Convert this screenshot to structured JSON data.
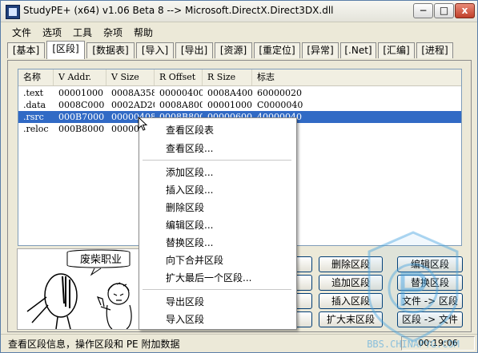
{
  "window": {
    "title": "StudyPE+ (x64) v1.06 Beta 8  --> Microsoft.DirectX.Direct3DX.dll",
    "controls": [
      "−",
      "□",
      "x"
    ]
  },
  "menu": [
    "文件",
    "选项",
    "工具",
    "杂项",
    "帮助"
  ],
  "tabs": [
    "[基本]",
    "[区段]",
    "[数据表]",
    "[导入]",
    "[导出]",
    "[资源]",
    "[重定位]",
    "[异常]",
    "[.Net]",
    "[汇编]",
    "[进程]"
  ],
  "table": {
    "columns": [
      "名称",
      "V Addr.",
      "V Size",
      "R Offset",
      "R Size",
      "标志"
    ],
    "rows": [
      [
        ".text",
        "00001000",
        "0008A358",
        "00000400",
        "0008A400",
        "60000020"
      ],
      [
        ".data",
        "0008C000",
        "0002AD20",
        "0008A800",
        "00001000",
        "C0000040"
      ],
      [
        ".rsrc",
        "000B7000",
        "00000408",
        "0008B800",
        "00000600",
        "40000040"
      ],
      [
        ".reloc",
        "000B8000",
        "00000A",
        "",
        "",
        ""
      ]
    ],
    "selected_row": 2
  },
  "comic_text": "废柴职业",
  "buttons": {
    "delete_section": "删除区段",
    "edit_section": "编辑区段",
    "append_section": "追加区段",
    "replace_section": "替换区段",
    "insert_section": "插入区段",
    "file_to_section": "文件 -> 区段",
    "expand_last": "扩大末区段",
    "section_to_file": "区段 -> 文件"
  },
  "context_menu": {
    "items": [
      "查看区段表",
      "查看区段...",
      "添加区段...",
      "插入区段...",
      "删除区段",
      "编辑区段...",
      "替换区段...",
      "向下合并区段",
      "扩大最后一个区段...",
      "导出区段",
      "导入区段"
    ]
  },
  "status": {
    "text": "查看区段信息，操作区段和 PE 附加数据",
    "time": "00:19:06"
  },
  "watermark_text": "BBS.CHINAPYG.COM",
  "colors": {
    "selection": "#316ac5",
    "watermark": "#4aa3e0"
  }
}
